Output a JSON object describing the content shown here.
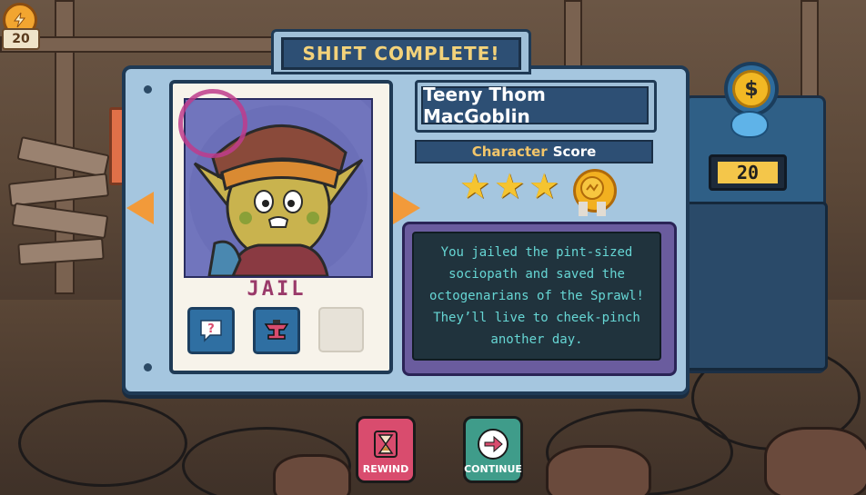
{
  "hud": {
    "currency_icon": "lightning-coin-icon",
    "currency_count": "20"
  },
  "dialog": {
    "title": "SHIFT COMPLETE!"
  },
  "character": {
    "name": "Teeny Thom MacGoblin",
    "verdict": "JAIL",
    "score_label_prefix": "Character",
    "score_label_suffix": "Score",
    "stars_filled": 3,
    "medal_icon": "gold-medal-icon",
    "description": "You jailed the pint-sized sociopath and saved the octogenarians of the Sprawl! They’ll live to cheek-pinch another day.",
    "evidence_slots": [
      {
        "icon": "question-speech-icon"
      },
      {
        "icon": "anvil-icon"
      },
      {
        "icon": "empty-slot"
      }
    ]
  },
  "machine": {
    "coin_symbol": "$",
    "count": "20"
  },
  "buttons": {
    "rewind_label": "REWIND",
    "continue_label": "CONTINUE"
  },
  "colors": {
    "panel": "#a5c6df",
    "title_bg": "#2d4f74",
    "title_text": "#f3d27a",
    "rewind": "#d94c6e",
    "continue": "#3f9c8a",
    "description_text": "#66d6d4"
  }
}
